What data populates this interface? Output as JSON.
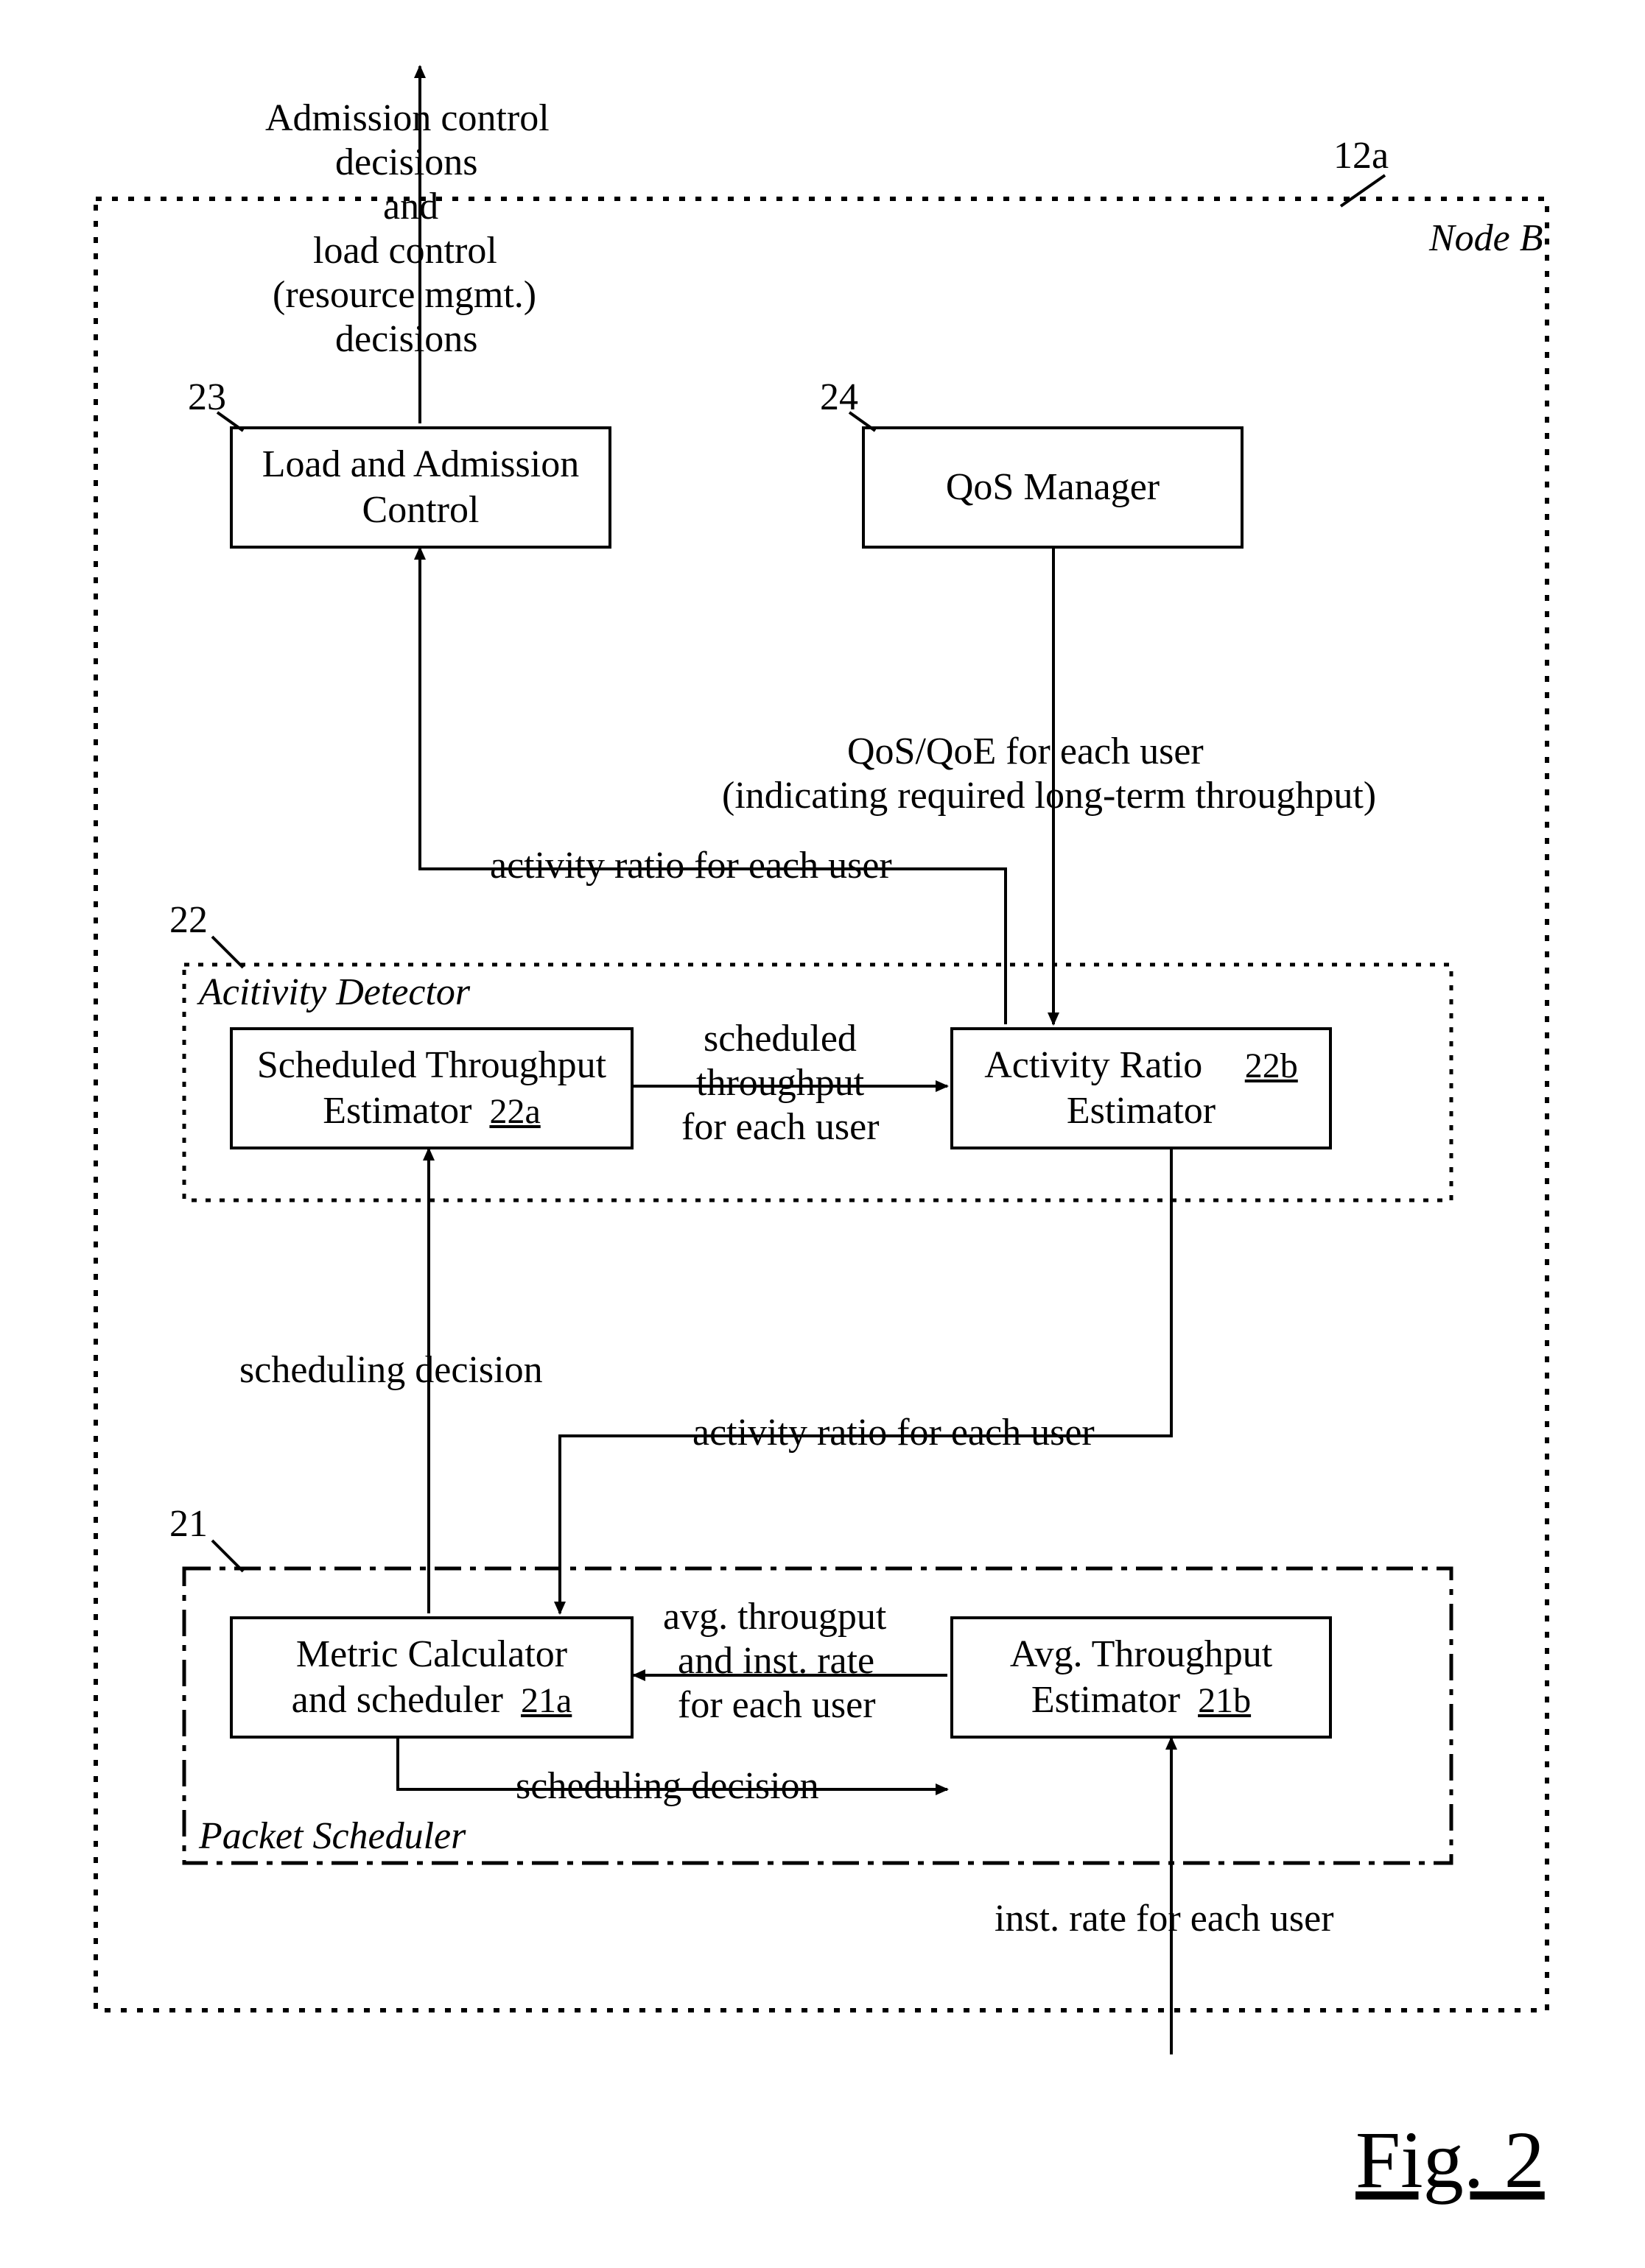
{
  "figure_caption": "Fig. 2",
  "nodeB": {
    "label": "Node B",
    "ref": "12a"
  },
  "packet_scheduler": {
    "label": "Packet Scheduler",
    "ref": "21",
    "metric_calc": {
      "line1": "Metric Calculator",
      "line2": "and scheduler",
      "ref": "21a"
    },
    "avg_tp_est": {
      "line1": "Avg. Throughput",
      "line2": "Estimator",
      "ref": "21b"
    }
  },
  "activity_detector": {
    "label": "Acitivity Detector",
    "ref": "22",
    "sched_tp_est": {
      "line1": "Scheduled Throughput",
      "line2": "Estimator",
      "ref": "22a"
    },
    "act_ratio_est": {
      "line1": "Activity Ratio",
      "line2": "Estimator",
      "ref": "22b"
    }
  },
  "load_admission": {
    "line1": "Load and Admission",
    "line2": "Control",
    "ref": "23"
  },
  "qos_manager": {
    "label": "QoS Manager",
    "ref": "24"
  },
  "edges": {
    "inst_rate_in": "inst. rate for each user",
    "avg_and_inst": {
      "l1": "avg. througput",
      "l2": "and inst. rate",
      "l3": "for each user"
    },
    "sched_decision_up": "scheduling decision",
    "sched_decision_right": "scheduling decision",
    "activity_ratio_down": "activity ratio for each user",
    "sched_throughput": {
      "l1": "scheduled",
      "l2": "throughput",
      "l3": "for each user"
    },
    "activity_ratio_up": "activity ratio for each user",
    "qos_qoe": {
      "l1": "QoS/QoE for each user",
      "l2": "(indicating required long-term throughput)"
    },
    "admission_out": {
      "l1": "Admission control",
      "l2": "decisions",
      "l3": "and",
      "l4": "load control",
      "l5": "(resource mgmt.)",
      "l6": "decisions"
    }
  }
}
